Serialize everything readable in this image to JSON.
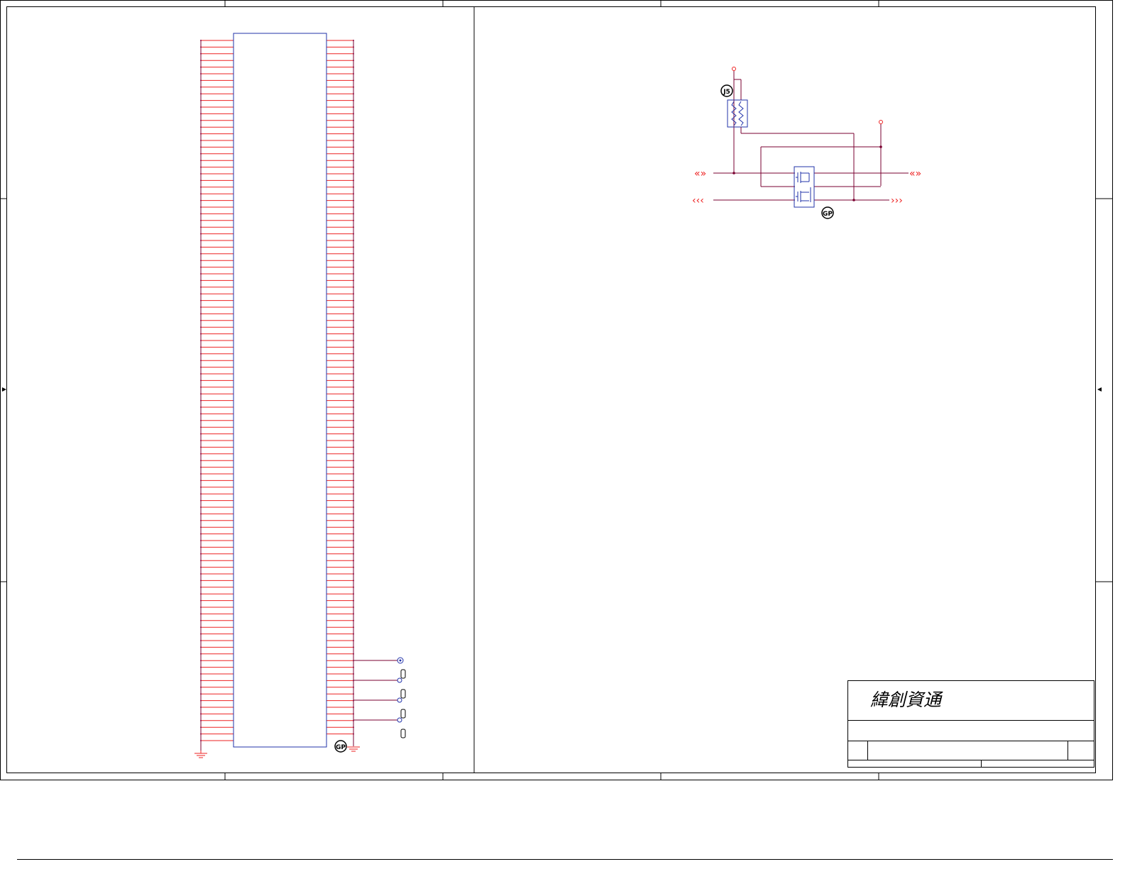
{
  "title_block": {
    "company": "緯創資通"
  },
  "labels": {
    "jumper_ref": "J5",
    "gp_left": "GP",
    "gp_right": "GP",
    "arrow_left_upper": "«»",
    "arrow_right_upper": "«»",
    "arrow_left_lower": "‹‹‹",
    "arrow_right_lower": "›››"
  },
  "colors": {
    "wire": "#7a0030",
    "pin": "#ee2222",
    "component": "#2233aa",
    "frame": "#000000",
    "pin_end": "#aa2266"
  }
}
